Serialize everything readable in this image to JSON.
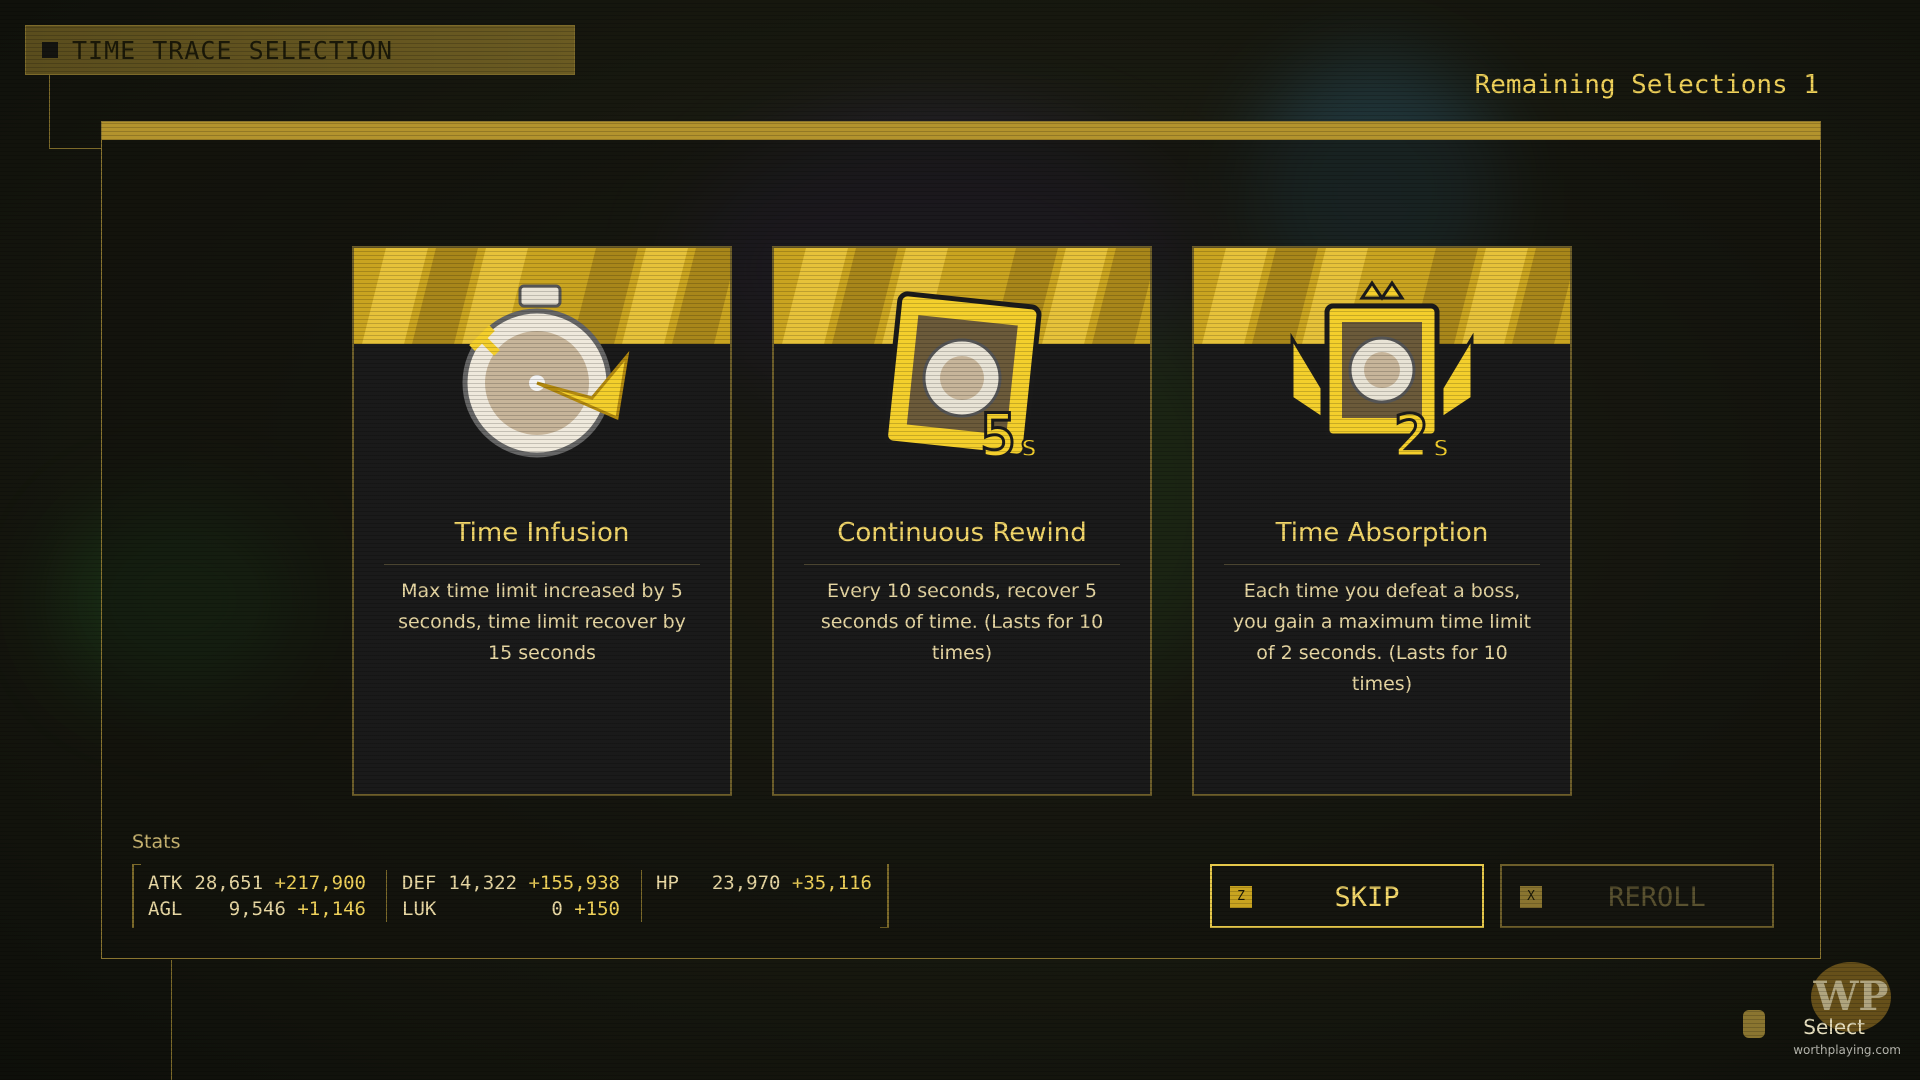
{
  "header": {
    "title": "TIME TRACE SELECTION"
  },
  "remaining": "Remaining Selections 1",
  "cards": [
    {
      "title": "Time Infusion",
      "description": "Max time limit increased by 5 seconds, time limit recover by 15 seconds",
      "icon": "stopwatch-icon"
    },
    {
      "title": "Continuous Rewind",
      "description": "Every 10 seconds, recover 5 seconds of time. (Lasts for 10 times)",
      "icon": "stopwatch-frame-5s-icon"
    },
    {
      "title": "Time Absorption",
      "description": "Each time you defeat a boss, you gain a maximum time limit of 2 seconds. (Lasts for 10 times)",
      "icon": "stopwatch-crown-2s-icon"
    }
  ],
  "stats": {
    "label": "Stats",
    "atk": {
      "key": "ATK",
      "base": "28,651",
      "bonus": "+217,900"
    },
    "agl": {
      "key": "AGL",
      "base": "9,546",
      "bonus": "+1,146"
    },
    "def": {
      "key": "DEF",
      "base": "14,322",
      "bonus": "+155,938"
    },
    "luk": {
      "key": "LUK",
      "base": "0",
      "bonus": "+150"
    },
    "hp": {
      "key": "HP",
      "base": "23,970",
      "bonus": "+35,116"
    }
  },
  "buttons": {
    "skip": {
      "key": "Z",
      "label": "SKIP"
    },
    "reroll": {
      "key": "X",
      "label": "REROLL"
    }
  },
  "hint": {
    "select": "Select"
  },
  "watermark": {
    "logo": "WP",
    "text": "worthplaying.com"
  },
  "colors": {
    "accent": "#c9a420",
    "text": "#f3d76a"
  }
}
